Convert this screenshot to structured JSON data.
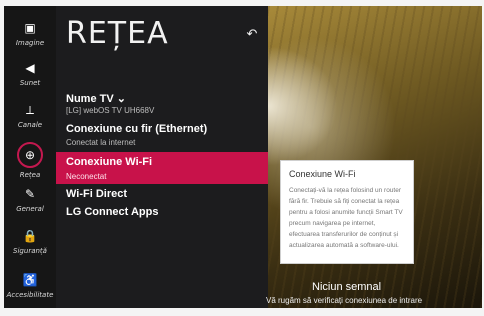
{
  "sidebar": {
    "items": [
      {
        "label": "Imagine",
        "icon": "picture-icon",
        "glyph": "▣"
      },
      {
        "label": "Sunet",
        "icon": "speaker-icon",
        "glyph": "◀"
      },
      {
        "label": "Canale",
        "icon": "antenna-icon",
        "glyph": "⟂"
      },
      {
        "label": "Rețea",
        "icon": "globe-icon",
        "glyph": "⊕"
      },
      {
        "label": "General",
        "icon": "general-icon",
        "glyph": "✎"
      },
      {
        "label": "Siguranță",
        "icon": "lock-icon",
        "glyph": "🔒"
      },
      {
        "label": "Accesibilitate",
        "icon": "accessibility-icon",
        "glyph": "♿"
      }
    ]
  },
  "panel": {
    "title": "REȚEA",
    "back_icon": "↶",
    "rows": [
      {
        "title": "Nume TV ⌄",
        "subtitle": "[LG] webOS TV UH668V"
      },
      {
        "title": "Conexiune cu fir (Ethernet)",
        "subtitle": "Conectat la internet"
      },
      {
        "title": "Conexiune Wi-Fi",
        "subtitle": "Neconectat"
      },
      {
        "title": "Wi-Fi Direct",
        "subtitle": ""
      },
      {
        "title": "LG Connect Apps",
        "subtitle": ""
      }
    ]
  },
  "tooltip": {
    "title": "Conexiune Wi-Fi",
    "body": "Conectați-vă la rețea folosind un router fără fir. Trebuie să fiți conectat la rețea pentru a folosi anumite funcții Smart TV precum navigarea pe internet, efectuarea transferurilor de conținut și actualizarea automată a software-ului."
  },
  "status": {
    "title": "Niciun semnal",
    "subtitle": "Vă rugăm să verificați conexiunea de intrare"
  },
  "colors": {
    "accent": "#c8124a",
    "panel": "#1c1c1e",
    "sidebar": "#161616"
  }
}
